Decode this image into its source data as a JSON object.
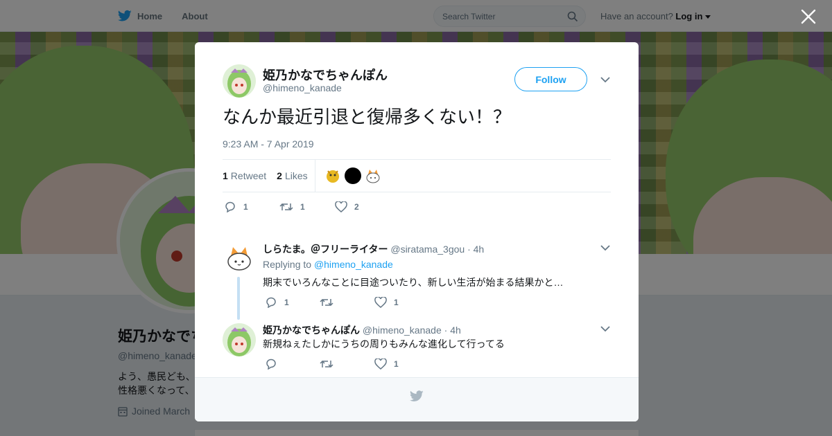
{
  "nav": {
    "home_label": "Home",
    "about_label": "About",
    "search_placeholder": "Search Twitter",
    "account_prompt": "Have an account?",
    "login_label": "Log in",
    "icons": [
      "twitter-bird-icon",
      "search-icon",
      "caret-down-icon",
      "close-icon"
    ]
  },
  "profile": {
    "name": "姫乃かなでちゃんぽん",
    "handle": "@himeno_kanade",
    "bio_line1": "よう、愚民ども、",
    "bio_line2": "性格悪くなって、",
    "joined": "Joined March"
  },
  "tweet": {
    "author_name": "姫乃かなでちゃんぽん",
    "author_handle": "@himeno_kanade",
    "follow_label": "Follow",
    "text": "なんか最近引退と復帰多くない！？",
    "timestamp": "9:23 AM - 7 Apr 2019",
    "retweet_count": "1",
    "retweet_label": "Retweet",
    "like_count": "2",
    "like_label": "Likes",
    "actions": {
      "reply_count": "1",
      "retweet_count": "1",
      "like_count": "2"
    }
  },
  "replies": [
    {
      "name": "しらたま。＠フリーライター",
      "handle": "@siratama_3gou",
      "time": "· 4h",
      "replying_prefix": "Replying to",
      "replying_to": "@himeno_kanade",
      "text": "期末でいろんなことに目途ついたり、新しい生活が始まる結果かと…",
      "reply_count": "1",
      "like_count": "1"
    },
    {
      "name": "姫乃かなでちゃんぽん",
      "handle": "@himeno_kanade",
      "time": "· 4h",
      "text": "新規ねぇたしかにうちの周りもみんな進化して行ってる",
      "like_count": "1"
    }
  ],
  "colors": {
    "accent": "#1da1f2",
    "text": "#14171a",
    "muted": "#657786",
    "border": "#e6ecf0",
    "thread_line": "#c4dff3"
  }
}
